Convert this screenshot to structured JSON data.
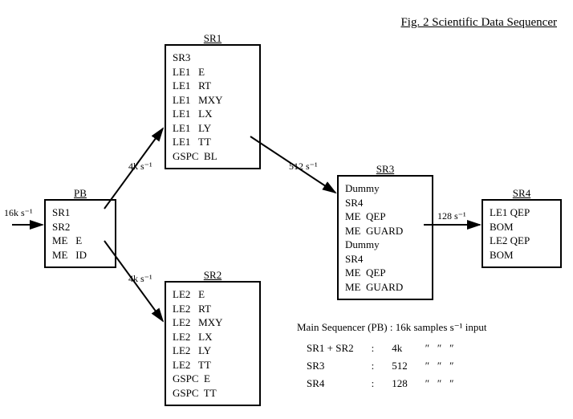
{
  "title": "Fig. 2   Scientific Data Sequencer",
  "rates": {
    "in": "16k s⁻¹",
    "r1": "4k s⁻¹",
    "r2": "4k s⁻¹",
    "r3": "512 s⁻¹",
    "r4": "128 s⁻¹"
  },
  "pb": {
    "name": "PB",
    "rows": [
      "SR1",
      "SR2",
      "ME   E",
      "ME   ID"
    ]
  },
  "sr1": {
    "name": "SR1",
    "rows": [
      "SR3",
      "LE1   E",
      "LE1   RT",
      "LE1   MXY",
      "LE1   LX",
      "LE1   LY",
      "LE1   TT",
      "GSPC  BL"
    ]
  },
  "sr2": {
    "name": "SR2",
    "rows": [
      "LE2   E",
      "LE2   RT",
      "LE2   MXY",
      "LE2   LX",
      "LE2   LY",
      "LE2   TT",
      "GSPC  E",
      "GSPC  TT"
    ]
  },
  "sr3": {
    "name": "SR3",
    "rows": [
      "Dummy",
      "SR4",
      "ME  QEP",
      "ME  GUARD",
      "Dummy",
      "SR4",
      "ME  QEP",
      "ME  GUARD"
    ]
  },
  "sr4": {
    "name": "SR4",
    "rows": [
      "LE1 QEP",
      "BOM",
      "LE2 QEP",
      "BOM"
    ]
  },
  "legend": {
    "hdr": "Main Sequencer (PB) :   16k  samples s⁻¹  input",
    "rows": [
      [
        "SR1 + SR2",
        ":",
        "4k",
        "″   ″   ″"
      ],
      [
        "SR3",
        ":",
        "512",
        "″   ″   ″"
      ],
      [
        "SR4",
        ":",
        "128",
        "″   ″   ″"
      ]
    ]
  }
}
